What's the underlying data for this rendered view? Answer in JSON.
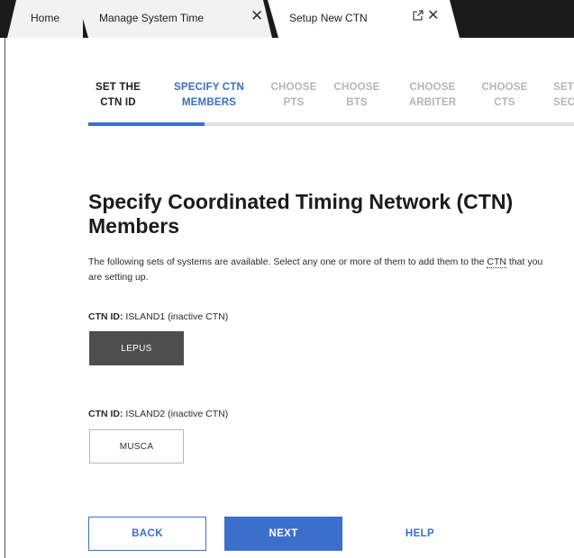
{
  "tabs": [
    {
      "label": "Home"
    },
    {
      "label": "Manage System Time",
      "close_glyph": "✕"
    },
    {
      "label": "Setup New CTN",
      "close_glyph": "✕",
      "popout_icon": "popout-icon"
    }
  ],
  "steps": [
    {
      "line1": "SET THE",
      "line2": "CTN ID",
      "state": "done"
    },
    {
      "line1": "SPECIFY CTN",
      "line2": "MEMBERS",
      "state": "active"
    },
    {
      "line1": "CHOOSE",
      "line2": "PTS",
      "state": "pending"
    },
    {
      "line1": "CHOOSE",
      "line2": "BTS",
      "state": "pending"
    },
    {
      "line1": "CHOOSE",
      "line2": "ARBITER",
      "state": "pending"
    },
    {
      "line1": "CHOOSE",
      "line2": "CTS",
      "state": "pending"
    },
    {
      "line1": "SET",
      "line2": "SEC",
      "state": "pending"
    }
  ],
  "progress": {
    "fraction": 0.24
  },
  "content": {
    "title": "Specify Coordinated Timing Network (CTN) Members",
    "desc_part1": "The following sets of systems are available. Select any one or more of them to add them to the",
    "desc_abbr": "CTN",
    "desc_part2": "that you are setting up."
  },
  "ctn_groups": [
    {
      "id_label": "CTN ID:",
      "id_value": "ISLAND1 (inactive CTN)",
      "system": "LEPUS",
      "selected": true
    },
    {
      "id_label": "CTN ID:",
      "id_value": "ISLAND2 (inactive CTN)",
      "system": "MUSCA",
      "selected": false
    }
  ],
  "actions": {
    "back": "BACK",
    "next": "NEXT",
    "help": "HELP"
  },
  "colors": {
    "accent": "#3b6fcb",
    "selected_system": "#4e4e4e",
    "tab_bar": "#1a1a1a"
  }
}
